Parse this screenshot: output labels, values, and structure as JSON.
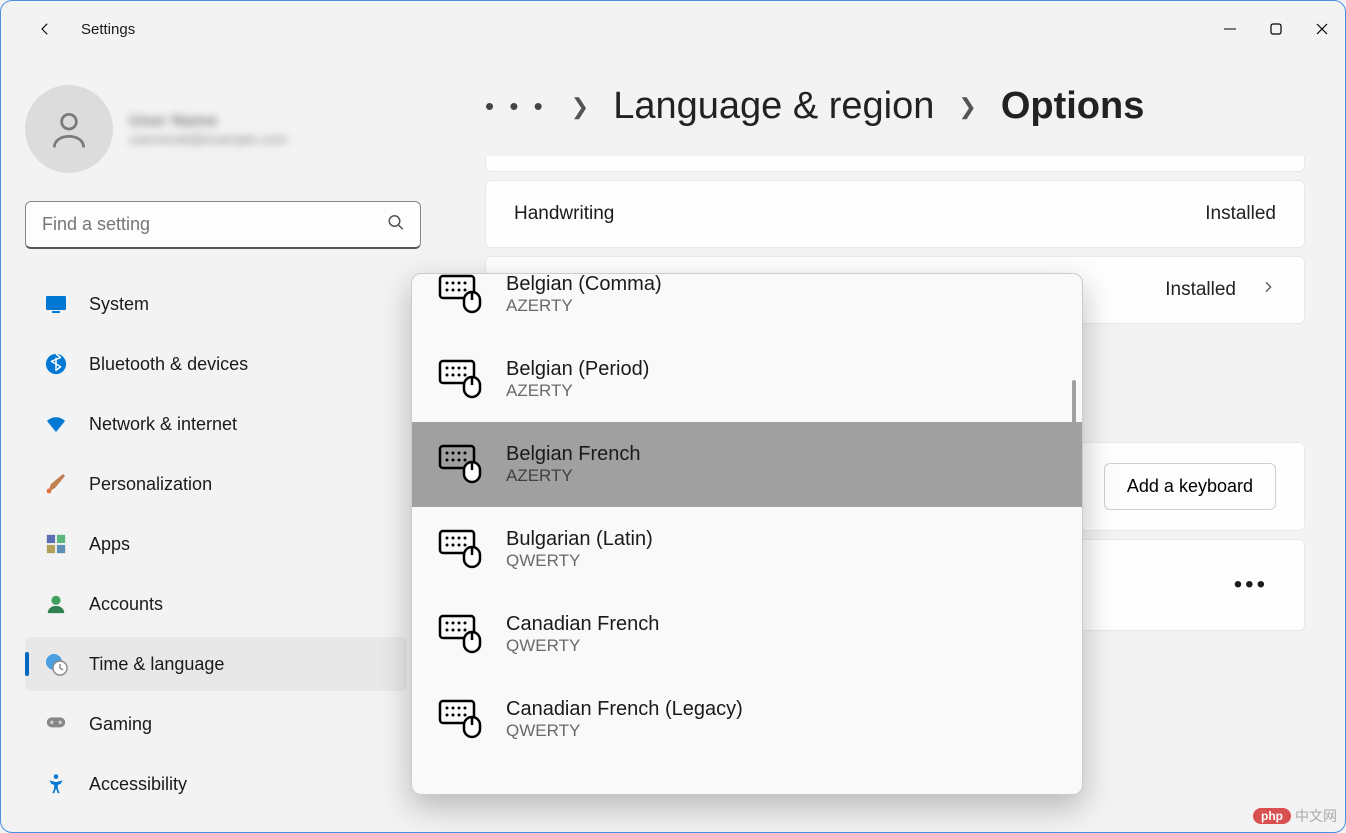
{
  "app": {
    "title": "Settings"
  },
  "user": {
    "name": "User Name",
    "email": "useremail@example.com"
  },
  "search": {
    "placeholder": "Find a setting"
  },
  "sidebar": {
    "items": [
      {
        "label": "System",
        "icon": "monitor",
        "color": "#0078d4"
      },
      {
        "label": "Bluetooth & devices",
        "icon": "bluetooth",
        "color": "#0078d4"
      },
      {
        "label": "Network & internet",
        "icon": "wifi",
        "color": "#0078d4"
      },
      {
        "label": "Personalization",
        "icon": "brush",
        "color": "#c06030"
      },
      {
        "label": "Apps",
        "icon": "apps",
        "color": "#5b6fb5"
      },
      {
        "label": "Accounts",
        "icon": "account",
        "color": "#40a060"
      },
      {
        "label": "Time & language",
        "icon": "globe-clock",
        "color": "#0078d4",
        "active": true
      },
      {
        "label": "Gaming",
        "icon": "gamepad",
        "color": "#888"
      },
      {
        "label": "Accessibility",
        "icon": "accessibility",
        "color": "#0078d4"
      }
    ]
  },
  "breadcrumb": {
    "ellipsis": "• • •",
    "item1": "Language & region",
    "item2": "Options"
  },
  "cards": {
    "handwriting": {
      "title": "Handwriting",
      "status": "Installed"
    },
    "second": {
      "status": "Installed"
    },
    "addKeyboard": {
      "button": "Add a keyboard"
    }
  },
  "keyboard_popup": {
    "items": [
      {
        "name": "Belgian (Comma)",
        "layout": "AZERTY"
      },
      {
        "name": "Belgian (Period)",
        "layout": "AZERTY"
      },
      {
        "name": "Belgian French",
        "layout": "AZERTY",
        "hovered": true
      },
      {
        "name": "Bulgarian (Latin)",
        "layout": "QWERTY"
      },
      {
        "name": "Canadian French",
        "layout": "QWERTY"
      },
      {
        "name": "Canadian French (Legacy)",
        "layout": "QWERTY"
      }
    ]
  },
  "watermark": {
    "badge": "php",
    "text": "中文网"
  }
}
